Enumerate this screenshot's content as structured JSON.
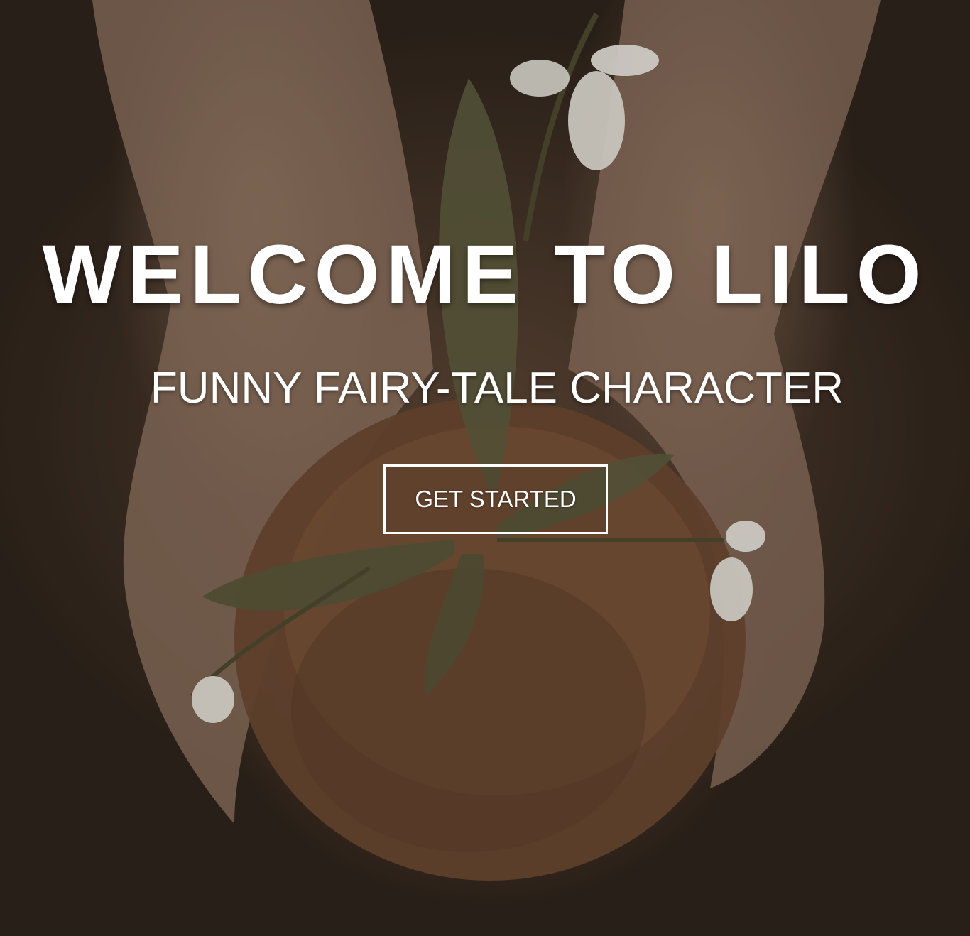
{
  "hero": {
    "title": "WELCOME TO LILO",
    "subtitle": "FUNNY FAIRY-TALE CHARACTER",
    "cta_label": "GET STARTED",
    "background_image": "hands-holding-moss-ball-with-snowdrop-flowers"
  },
  "colors": {
    "text": "#ffffff",
    "background_dark": "#2a2119",
    "soil": "#7e5438",
    "leaf": "#5c5a3c",
    "flower": "#f2f0ea"
  }
}
